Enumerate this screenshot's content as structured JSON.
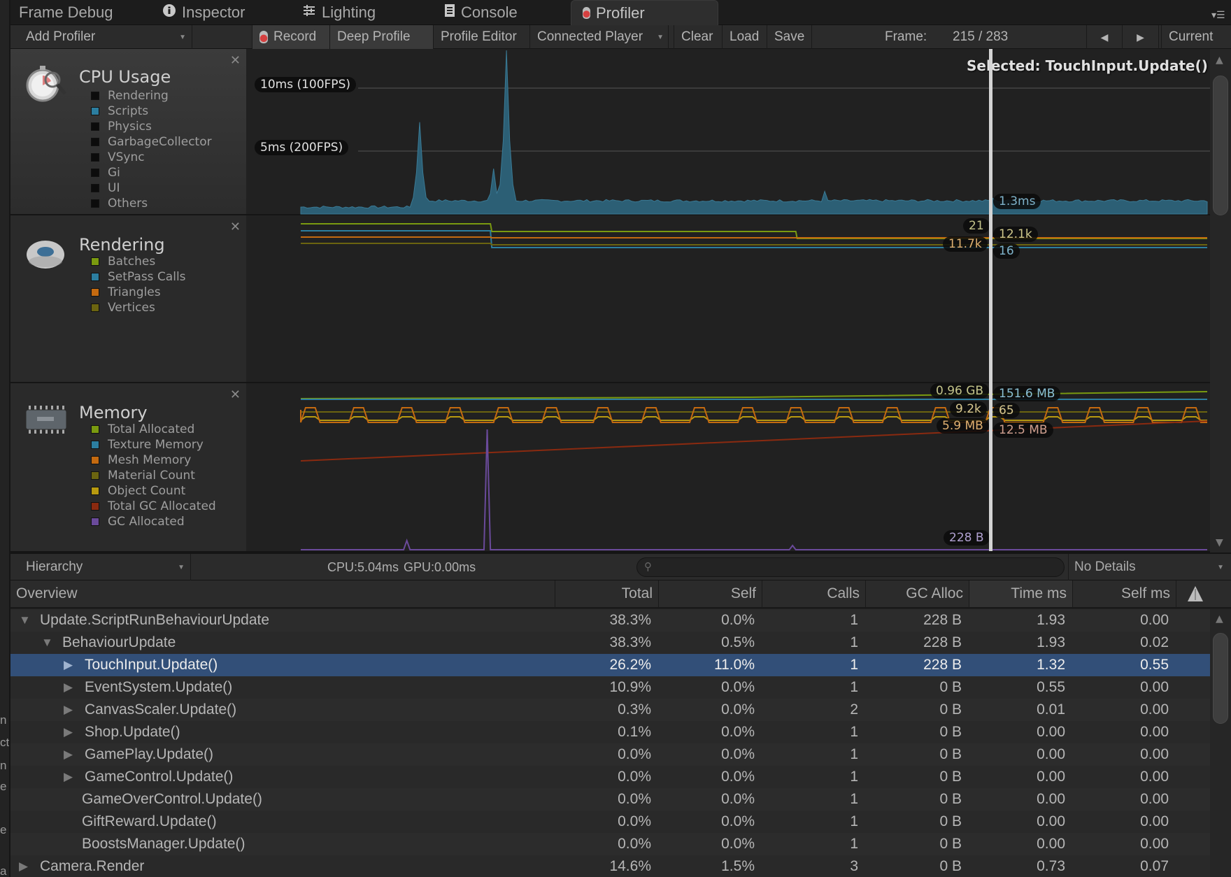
{
  "tabs": [
    {
      "label": "Frame Debug",
      "icon": "",
      "active": false
    },
    {
      "label": "Inspector",
      "icon": "info-icon",
      "active": false
    },
    {
      "label": "Lighting",
      "icon": "sliders-icon",
      "active": false
    },
    {
      "label": "Console",
      "icon": "console-icon",
      "active": false
    },
    {
      "label": "Profiler",
      "icon": "profiler-icon",
      "active": true
    }
  ],
  "toolbar": {
    "add_profiler": "Add Profiler",
    "record": "Record",
    "deep_profile": "Deep Profile",
    "profile_editor": "Profile Editor",
    "connected_player": "Connected Player",
    "clear": "Clear",
    "load": "Load",
    "save": "Save",
    "frame_label": "Frame:",
    "frame_value": "215 / 283",
    "prev": "◀",
    "next": "▶",
    "current": "Current"
  },
  "selected_label": "Selected: TouchInput.Update()",
  "cpu_panel": {
    "title": "CPU Usage",
    "legend": [
      {
        "label": "Rendering",
        "color": "#0c0c0c"
      },
      {
        "label": "Scripts",
        "color": "#2c7ea0"
      },
      {
        "label": "Physics",
        "color": "#0c0c0c"
      },
      {
        "label": "GarbageCollector",
        "color": "#0c0c0c"
      },
      {
        "label": "VSync",
        "color": "#0c0c0c"
      },
      {
        "label": "Gi",
        "color": "#0c0c0c"
      },
      {
        "label": "UI",
        "color": "#0c0c0c"
      },
      {
        "label": "Others",
        "color": "#0c0c0c"
      }
    ],
    "gridlines": [
      {
        "label": "10ms (100FPS)",
        "value": 10
      },
      {
        "label": "5ms (200FPS)",
        "value": 5
      }
    ],
    "selected_value": "1.3ms"
  },
  "rendering_panel": {
    "title": "Rendering",
    "legend": [
      {
        "label": "Batches",
        "color": "#7a9a10"
      },
      {
        "label": "SetPass Calls",
        "color": "#2c7ea0"
      },
      {
        "label": "Triangles",
        "color": "#c46a10"
      },
      {
        "label": "Vertices",
        "color": "#6b6410"
      }
    ],
    "values_left": [
      "21",
      "11.7k"
    ],
    "values_right": [
      "12.1k",
      "16"
    ]
  },
  "memory_panel": {
    "title": "Memory",
    "legend": [
      {
        "label": "Total Allocated",
        "color": "#7a9a10"
      },
      {
        "label": "Texture Memory",
        "color": "#2c7ea0"
      },
      {
        "label": "Mesh Memory",
        "color": "#c46a10"
      },
      {
        "label": "Material Count",
        "color": "#6b6410"
      },
      {
        "label": "Object Count",
        "color": "#b89a10"
      },
      {
        "label": "Total GC Allocated",
        "color": "#8a2a10"
      },
      {
        "label": "GC Allocated",
        "color": "#6a4a9a"
      }
    ],
    "values_left": [
      "0.96 GB",
      "9.2k",
      "5.9 MB",
      "228 B"
    ],
    "values_right": [
      "151.6 MB",
      "65",
      "12.5 MB"
    ]
  },
  "chart_data": [
    {
      "type": "area",
      "title": "CPU Usage",
      "ylabel": "ms",
      "ylim": [
        0,
        13
      ],
      "frames": 283,
      "selected_frame": 215,
      "series": [
        {
          "name": "Scripts",
          "color": "#2c5f75",
          "baseline_ms": 0.9,
          "spikes": [
            {
              "frame": 37,
              "ms": 7.3
            },
            {
              "frame": 60,
              "ms": 3.6
            },
            {
              "frame": 64,
              "ms": 13.0
            },
            {
              "frame": 163,
              "ms": 1.8
            },
            {
              "frame": 215,
              "ms": 1.3
            }
          ]
        }
      ]
    },
    {
      "type": "line",
      "title": "Rendering",
      "frames": 283,
      "selected_frame": 215,
      "series": [
        {
          "name": "Batches",
          "values_note": "steps down at frame ~59 and ~154",
          "current": 21
        },
        {
          "name": "SetPass Calls",
          "values_note": "steps down at frame ~59",
          "current": 16
        },
        {
          "name": "Triangles",
          "current": "12.1k"
        },
        {
          "name": "Vertices",
          "current": "11.7k"
        }
      ]
    },
    {
      "type": "line",
      "title": "Memory",
      "frames": 283,
      "selected_frame": 215,
      "series": [
        {
          "name": "Total Allocated",
          "current": "0.96 GB"
        },
        {
          "name": "Texture Memory",
          "current": "151.6 MB"
        },
        {
          "name": "Mesh Memory",
          "current": "5.9 MB"
        },
        {
          "name": "Material Count",
          "current": "65"
        },
        {
          "name": "Object Count",
          "current": "9.2k"
        },
        {
          "name": "Total GC Allocated",
          "current": "12.5 MB"
        },
        {
          "name": "GC Allocated",
          "current": "228 B"
        }
      ]
    }
  ],
  "hierarchy_toolbar": {
    "view_select": "Hierarchy",
    "cpu_gpu": "CPU:5.04ms   GPU:0.00ms",
    "search_placeholder": "",
    "details_select": "No Details"
  },
  "table": {
    "columns": [
      "Overview",
      "Total",
      "Self",
      "Calls",
      "GC Alloc",
      "Time ms",
      "Self ms"
    ],
    "sorted_column": "Time ms",
    "rows": [
      {
        "name": "Update.ScriptRunBehaviourUpdate",
        "depth": 0,
        "expander": "open",
        "total": "38.3%",
        "self": "0.0%",
        "calls": "1",
        "gc": "228 B",
        "time": "1.93",
        "selfms": "0.00"
      },
      {
        "name": "BehaviourUpdate",
        "depth": 1,
        "expander": "open",
        "total": "38.3%",
        "self": "0.5%",
        "calls": "1",
        "gc": "228 B",
        "time": "1.93",
        "selfms": "0.02"
      },
      {
        "name": "TouchInput.Update()",
        "depth": 2,
        "expander": "closed",
        "selected": true,
        "total": "26.2%",
        "self": "11.0%",
        "calls": "1",
        "gc": "228 B",
        "time": "1.32",
        "selfms": "0.55"
      },
      {
        "name": "EventSystem.Update()",
        "depth": 2,
        "expander": "closed",
        "total": "10.9%",
        "self": "0.0%",
        "calls": "1",
        "gc": "0 B",
        "time": "0.55",
        "selfms": "0.00"
      },
      {
        "name": "CanvasScaler.Update()",
        "depth": 2,
        "expander": "closed",
        "total": "0.3%",
        "self": "0.0%",
        "calls": "2",
        "gc": "0 B",
        "time": "0.01",
        "selfms": "0.00"
      },
      {
        "name": "Shop.Update()",
        "depth": 2,
        "expander": "closed",
        "total": "0.1%",
        "self": "0.0%",
        "calls": "1",
        "gc": "0 B",
        "time": "0.00",
        "selfms": "0.00"
      },
      {
        "name": "GamePlay.Update()",
        "depth": 2,
        "expander": "closed",
        "total": "0.0%",
        "self": "0.0%",
        "calls": "1",
        "gc": "0 B",
        "time": "0.00",
        "selfms": "0.00"
      },
      {
        "name": "GameControl.Update()",
        "depth": 2,
        "expander": "closed",
        "total": "0.0%",
        "self": "0.0%",
        "calls": "1",
        "gc": "0 B",
        "time": "0.00",
        "selfms": "0.00"
      },
      {
        "name": "GameOverControl.Update()",
        "depth": 2,
        "expander": "none",
        "total": "0.0%",
        "self": "0.0%",
        "calls": "1",
        "gc": "0 B",
        "time": "0.00",
        "selfms": "0.00"
      },
      {
        "name": "GiftReward.Update()",
        "depth": 2,
        "expander": "none",
        "total": "0.0%",
        "self": "0.0%",
        "calls": "1",
        "gc": "0 B",
        "time": "0.00",
        "selfms": "0.00"
      },
      {
        "name": "BoostsManager.Update()",
        "depth": 2,
        "expander": "none",
        "total": "0.0%",
        "self": "0.0%",
        "calls": "1",
        "gc": "0 B",
        "time": "0.00",
        "selfms": "0.00"
      },
      {
        "name": "Camera.Render",
        "depth": 0,
        "expander": "closed",
        "total": "14.6%",
        "self": "1.5%",
        "calls": "3",
        "gc": "0 B",
        "time": "0.73",
        "selfms": "0.07"
      }
    ]
  },
  "left_strip_fragments": [
    "n",
    "ct",
    "n",
    "e",
    "e",
    "a"
  ]
}
